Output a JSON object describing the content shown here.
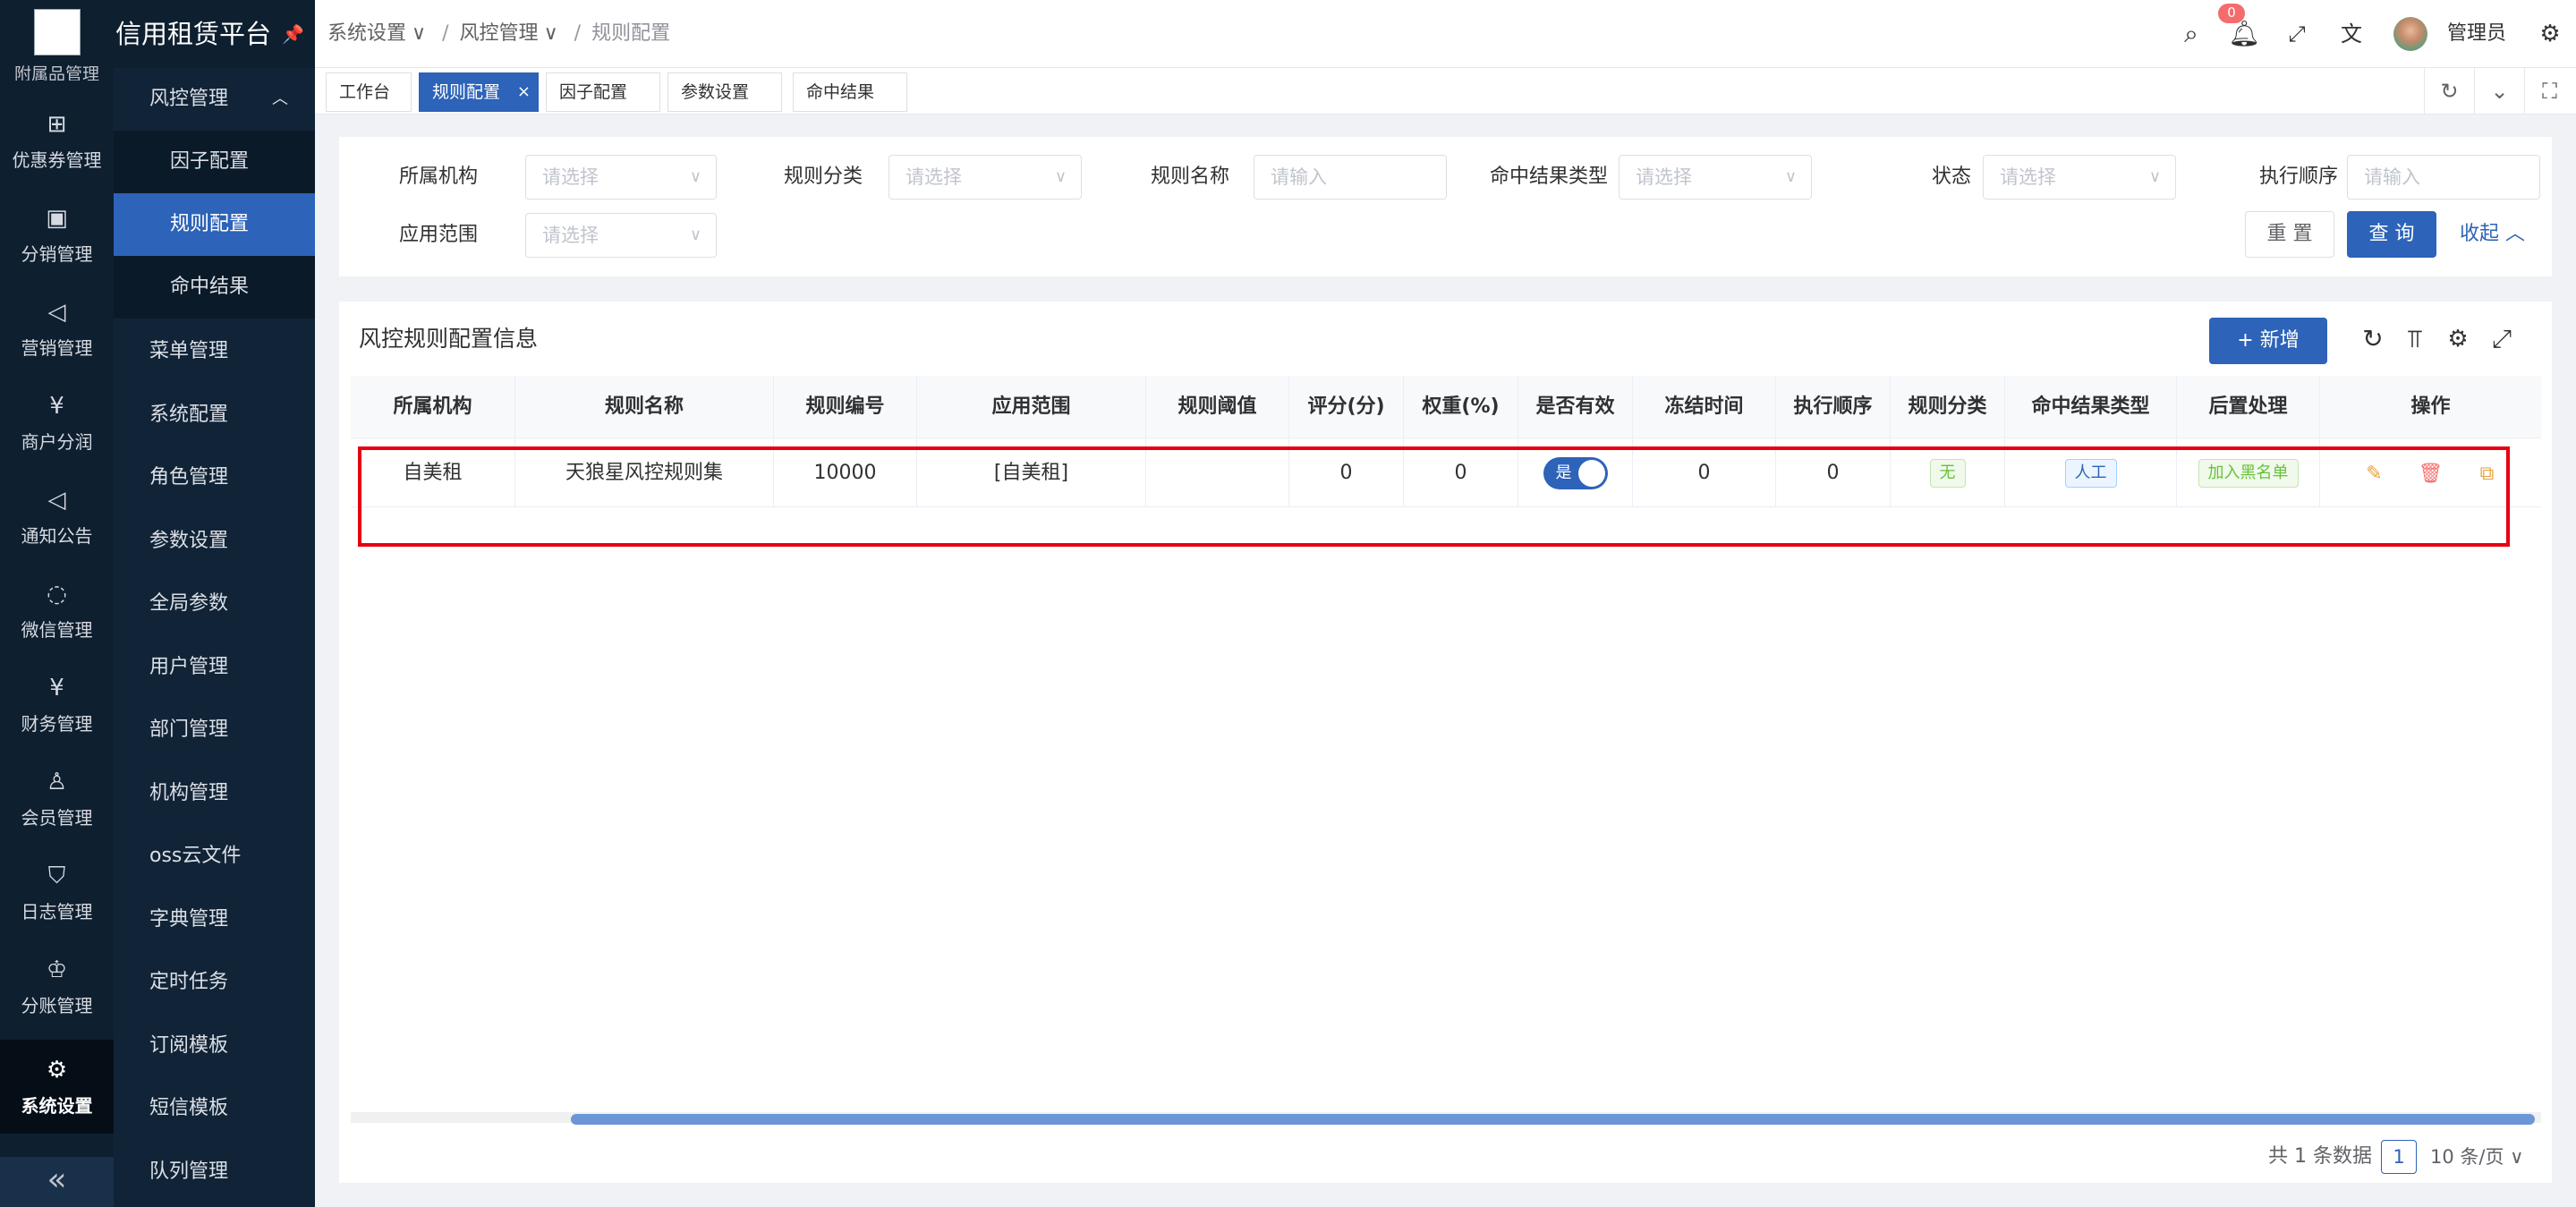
{
  "app": {
    "brand": "信用租赁平台",
    "logo_alt": "附属品管理"
  },
  "nav1": [
    {
      "label": "优惠券管理",
      "icon": "gift-icon"
    },
    {
      "label": "分销管理",
      "icon": "chart-icon"
    },
    {
      "label": "营销管理",
      "icon": "megaphone-icon"
    },
    {
      "label": "商户分润",
      "icon": "yen-icon"
    },
    {
      "label": "通知公告",
      "icon": "notice-icon"
    },
    {
      "label": "微信管理",
      "icon": "wechat-icon"
    },
    {
      "label": "财务管理",
      "icon": "finance-icon"
    },
    {
      "label": "会员管理",
      "icon": "user-icon"
    },
    {
      "label": "日志管理",
      "icon": "shield-icon"
    },
    {
      "label": "分账管理",
      "icon": "crown-icon"
    },
    {
      "label": "系统设置",
      "icon": "gear-icon"
    }
  ],
  "nav2": {
    "group": "风控管理",
    "subitems": [
      "因子配置",
      "规则配置",
      "命中结果"
    ],
    "items": [
      "菜单管理",
      "系统配置",
      "角色管理",
      "参数设置",
      "全局参数",
      "用户管理",
      "部门管理",
      "机构管理",
      "oss云文件",
      "字典管理",
      "定时任务",
      "订阅模板",
      "短信模板",
      "队列管理"
    ]
  },
  "breadcrumb": [
    "系统设置",
    "风控管理",
    "规则配置"
  ],
  "header": {
    "notification_count": "0",
    "username": "管理员"
  },
  "tabs": [
    "工作台",
    "规则配置",
    "因子配置",
    "参数设置",
    "命中结果"
  ],
  "search": {
    "fields": [
      {
        "label": "所属机构",
        "placeholder": "请选择",
        "type": "select"
      },
      {
        "label": "规则分类",
        "placeholder": "请选择",
        "type": "select"
      },
      {
        "label": "规则名称",
        "placeholder": "请输入",
        "type": "input"
      },
      {
        "label": "命中结果类型",
        "placeholder": "请选择",
        "type": "select"
      },
      {
        "label": "状态",
        "placeholder": "请选择",
        "type": "select"
      },
      {
        "label": "执行顺序",
        "placeholder": "请输入",
        "type": "input"
      },
      {
        "label": "应用范围",
        "placeholder": "请选择",
        "type": "select"
      }
    ],
    "reset": "重 置",
    "query": "查 询",
    "collapse": "收起"
  },
  "panel": {
    "title": "风控规则配置信息",
    "add": "新增"
  },
  "table": {
    "columns": [
      "所属机构",
      "规则名称",
      "规则编号",
      "应用范围",
      "规则阈值",
      "评分(分)",
      "权重(%)",
      "是否有效",
      "冻结时间",
      "执行顺序",
      "规则分类",
      "命中结果类型",
      "后置处理",
      "操作"
    ],
    "rows": [
      {
        "org": "自美租",
        "name": "天狼星风控规则集",
        "code": "10000",
        "scope": "[自美租]",
        "threshold": "",
        "score": "0",
        "weight": "0",
        "valid": "是",
        "freeze": "0",
        "order": "0",
        "category": "无",
        "hit_type": "人工",
        "post": "加入黑名单"
      }
    ]
  },
  "pagination": {
    "total": "共 1 条数据",
    "page": "1",
    "size": "10 条/页"
  }
}
